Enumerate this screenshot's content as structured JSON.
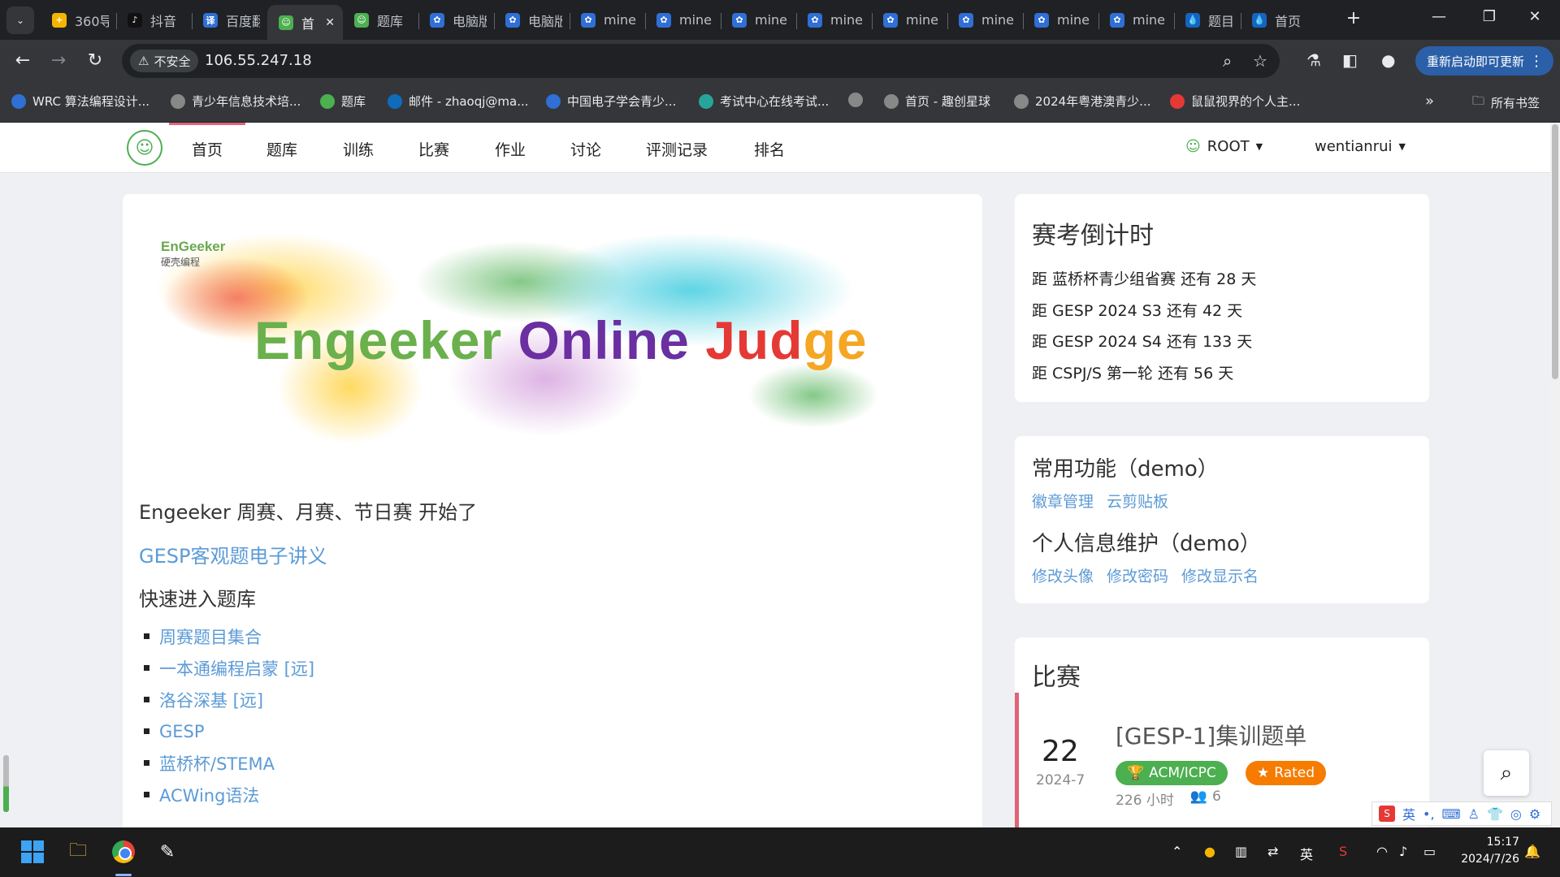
{
  "browser": {
    "tabs": [
      {
        "title": "360导",
        "fav_color": "#f5b400",
        "fav_glyph": "+"
      },
      {
        "title": "抖音",
        "fav_color": "#111111",
        "fav_glyph": "♪"
      },
      {
        "title": "百度翻",
        "fav_color": "#2f6fd6",
        "fav_glyph": "译"
      },
      {
        "title": "首",
        "fav_color": "#4caf50",
        "fav_glyph": "☺",
        "active": true
      },
      {
        "title": "题库",
        "fav_color": "#4caf50",
        "fav_glyph": "☺"
      },
      {
        "title": "电脑版",
        "fav_color": "#2f6fd6",
        "fav_glyph": "✿"
      },
      {
        "title": "电脑版",
        "fav_color": "#2f6fd6",
        "fav_glyph": "✿"
      },
      {
        "title": "mine",
        "fav_color": "#2f6fd6",
        "fav_glyph": "✿"
      },
      {
        "title": "mine",
        "fav_color": "#2f6fd6",
        "fav_glyph": "✿"
      },
      {
        "title": "mine",
        "fav_color": "#2f6fd6",
        "fav_glyph": "✿"
      },
      {
        "title": "mine",
        "fav_color": "#2f6fd6",
        "fav_glyph": "✿"
      },
      {
        "title": "mine",
        "fav_color": "#2f6fd6",
        "fav_glyph": "✿"
      },
      {
        "title": "mine",
        "fav_color": "#2f6fd6",
        "fav_glyph": "✿"
      },
      {
        "title": "mine",
        "fav_color": "#2f6fd6",
        "fav_glyph": "✿"
      },
      {
        "title": "mine",
        "fav_color": "#2f6fd6",
        "fav_glyph": "✿"
      },
      {
        "title": "题目",
        "fav_color": "#1565c0",
        "fav_glyph": "💧"
      },
      {
        "title": "首页",
        "fav_color": "#1565c0",
        "fav_glyph": "💧"
      }
    ],
    "security_label": "不安全",
    "url": "106.55.247.18",
    "update_button": "重新启动即可更新",
    "bookmarks": [
      {
        "label": "WRC 算法编程设计...",
        "color": "#2f6fd6"
      },
      {
        "label": "青少年信息技术培...",
        "color": "#888888"
      },
      {
        "label": "题库",
        "color": "#4caf50"
      },
      {
        "label": "邮件 - zhaoqj@ma...",
        "color": "#0f6cbd"
      },
      {
        "label": "中国电子学会青少...",
        "color": "#2f6fd6"
      },
      {
        "label": "考试中心在线考试...",
        "color": "#26a69a"
      },
      {
        "label": "",
        "color": "#888888"
      },
      {
        "label": "首页 - 趣创星球",
        "color": "#888888"
      },
      {
        "label": "2024年粤港澳青少...",
        "color": "#888888"
      },
      {
        "label": "鼠鼠视界的个人主...",
        "color": "#e53935"
      }
    ],
    "all_bookmarks": "所有书签"
  },
  "site": {
    "nav": [
      "首页",
      "题库",
      "训练",
      "比赛",
      "作业",
      "讨论",
      "评测记录",
      "排名"
    ],
    "root_menu": "ROOT",
    "user_menu": "wentianrui"
  },
  "main": {
    "brand_en": "EnGeeker",
    "brand_cn": "硬壳编程",
    "banner_words": [
      "Engeeker",
      "Online",
      "Jud",
      "ge"
    ],
    "intro": "Engeeker 周赛、月赛、节日赛 开始了",
    "gesp_link": "GESP客观题电子讲义",
    "quick_heading": "快速进入题库",
    "quick_links": [
      "周赛题目集合",
      "一本通编程启蒙 [远]",
      "洛谷深基 [远]",
      "GESP",
      "蓝桥杯/STEMA",
      "ACWing语法"
    ]
  },
  "countdown": {
    "title": "赛考倒计时",
    "items": [
      "距 蓝桥杯青少组省赛 还有 28 天",
      "距 GESP 2024 S3 还有 42 天",
      "距 GESP 2024 S4 还有 133 天",
      "距 CSPJ/S 第一轮 还有 56 天"
    ]
  },
  "functions": {
    "title1": "常用功能（demo）",
    "links1": [
      "徽章管理",
      "云剪贴板"
    ],
    "title2": "个人信息维护（demo）",
    "links2": [
      "修改头像",
      "修改密码",
      "修改显示名"
    ]
  },
  "contest": {
    "section_title": "比赛",
    "day": "22",
    "month": "2024-7",
    "title": "[GESP-1]集训题单",
    "tag_rule": "ACM/ICPC",
    "tag_rated": "Rated",
    "duration": "226 小时",
    "participants": "6",
    "accent_color": "#e06377",
    "rule_color": "#4caf50",
    "rated_color": "#f57c00"
  },
  "ime": {
    "mode": "英"
  },
  "taskbar": {
    "ime": "英",
    "time": "15:17",
    "date": "2024/7/26"
  }
}
